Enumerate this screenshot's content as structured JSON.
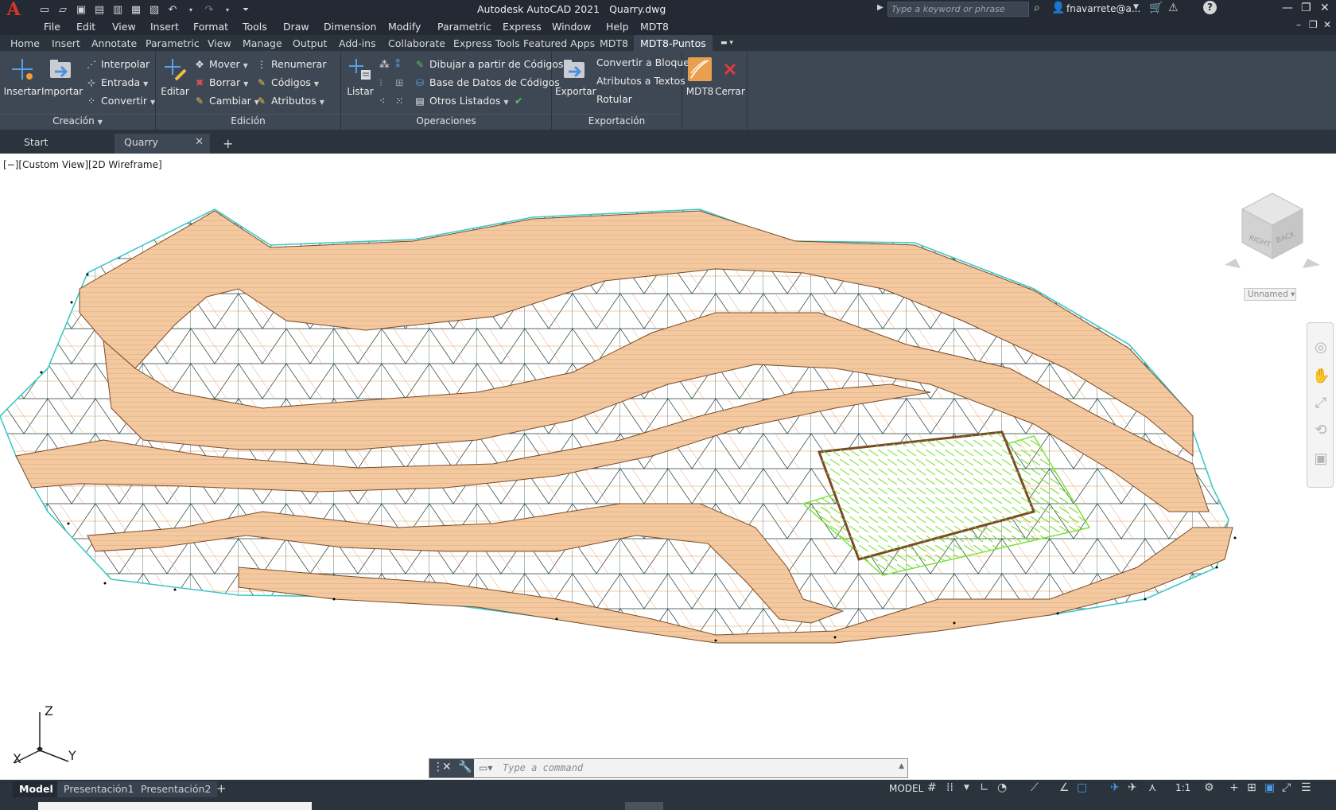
{
  "app": {
    "title": "Autodesk AutoCAD 2021",
    "file": "Quarry.dwg",
    "logo_letter": "A"
  },
  "search": {
    "placeholder": "Type a keyword or phrase"
  },
  "user": {
    "name": "fnavarrete@a..."
  },
  "menu": [
    "File",
    "Edit",
    "View",
    "Insert",
    "Format",
    "Tools",
    "Draw",
    "Dimension",
    "Modify",
    "Parametric",
    "Express",
    "Window",
    "Help",
    "MDT8"
  ],
  "ribbon_tabs": [
    "Home",
    "Insert",
    "Annotate",
    "Parametric",
    "View",
    "Manage",
    "Output",
    "Add-ins",
    "Collaborate",
    "Express Tools",
    "Featured Apps",
    "MDT8",
    "MDT8-Puntos"
  ],
  "ribbon_active_tab": "MDT8-Puntos",
  "panels": {
    "creacion": {
      "title": "Creación",
      "insertar": "Insertar",
      "importar": "Importar",
      "interpolar": "Interpolar",
      "entrada": "Entrada",
      "convertir": "Convertir"
    },
    "edicion": {
      "title": "Edición",
      "editar": "Editar",
      "mover": "Mover",
      "borrar": "Borrar",
      "cambiar": "Cambiar",
      "renumerar": "Renumerar",
      "codigos": "Códigos",
      "atributos": "Atributos"
    },
    "operaciones": {
      "title": "Operaciones",
      "listar": "Listar",
      "dibujar": "Dibujar a partir de Códigos",
      "base_datos": "Base de Datos de Códigos",
      "otros": "Otros Listados"
    },
    "exportacion": {
      "title": "Exportación",
      "exportar": "Exportar",
      "convertir_bloques": "Convertir a Bloques",
      "atributos_textos": "Atributos a Textos",
      "rotular": "Rotular"
    },
    "mdt8": {
      "mdt8": "MDT8",
      "cerrar": "Cerrar"
    }
  },
  "file_tabs": {
    "start": "Start",
    "current": "Quarry"
  },
  "viewport_label": "[−][Custom View][2D Wireframe]",
  "viewcube": {
    "right": "RIGHT",
    "back": "BACK",
    "ucs_name": "Unnamed"
  },
  "ucs": {
    "x": "X",
    "y": "Y",
    "z": "Z"
  },
  "command": {
    "placeholder": "Type  a  command"
  },
  "layout_tabs": {
    "model": "Model",
    "layout1": "Presentación1",
    "layout2": "Presentación2"
  },
  "status": {
    "model": "MODEL",
    "scale": "1:1"
  },
  "colors": {
    "terrain_fill": "#f4c9a0",
    "terrain_line": "#7a4a25",
    "contour": "#e8a060",
    "tin": "#1f3b3a",
    "boundary": "#3ec8c8",
    "platform_green": "#7ee23a",
    "ribbon_bg": "#3e4754",
    "titlebar_bg": "#232a33"
  }
}
